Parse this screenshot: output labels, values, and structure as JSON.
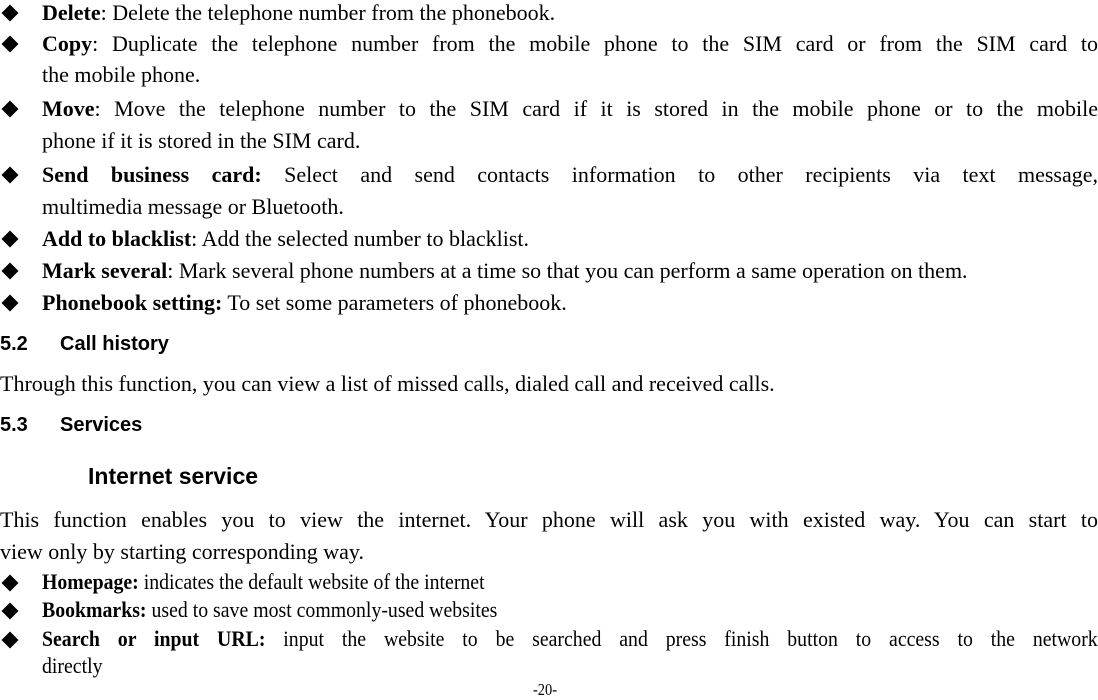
{
  "phonebook_options": [
    {
      "term": "Delete",
      "sep": ":",
      "desc": " Delete the telephone number from the phonebook."
    },
    {
      "term": "Copy",
      "sep": ":",
      "desc_line1": " Duplicate the telephone number from the mobile phone to the SIM card or from the SIM card to",
      "desc_line2": "the mobile phone."
    },
    {
      "term": "Move",
      "sep": ":",
      "desc_line1": " Move the telephone number to the SIM card if it is stored in the mobile phone or to the mobile",
      "desc_line2": "phone if it is stored in the SIM card."
    },
    {
      "term": "Send business card:",
      "desc_line1": " Select and send contacts information to other recipients via text message,",
      "desc_line2": "multimedia message or Bluetooth."
    },
    {
      "term": "Add to blacklist",
      "sep": ":",
      "desc": " Add the selected number to blacklist."
    },
    {
      "term": "Mark several",
      "sep": ":",
      "desc": " Mark several phone numbers at a time so that you can perform a same operation on them."
    },
    {
      "term": "Phonebook setting:",
      "desc": " To set some parameters of phonebook."
    }
  ],
  "section_52": {
    "number": "5.2",
    "title": "Call history",
    "body": "Through this function, you can view a list of missed calls, dialed call and received calls."
  },
  "section_53": {
    "number": "5.3",
    "title": "Services",
    "subtitle": "Internet service",
    "body_line1": "This function enables you to view the internet. Your phone will ask you with existed way. You can start to",
    "body_line2": "view only by starting corresponding way."
  },
  "internet_options": [
    {
      "term": "Homepage:",
      "desc": " indicates the default website of the internet"
    },
    {
      "term": "Bookmarks:",
      "desc": " used to save most commonly-used websites"
    },
    {
      "term": "Search or input URL:",
      "desc_line1": " input the website to be searched and press finish button to access to the network",
      "desc_line2": "directly"
    }
  ],
  "footer": {
    "page_number": "-20-"
  }
}
